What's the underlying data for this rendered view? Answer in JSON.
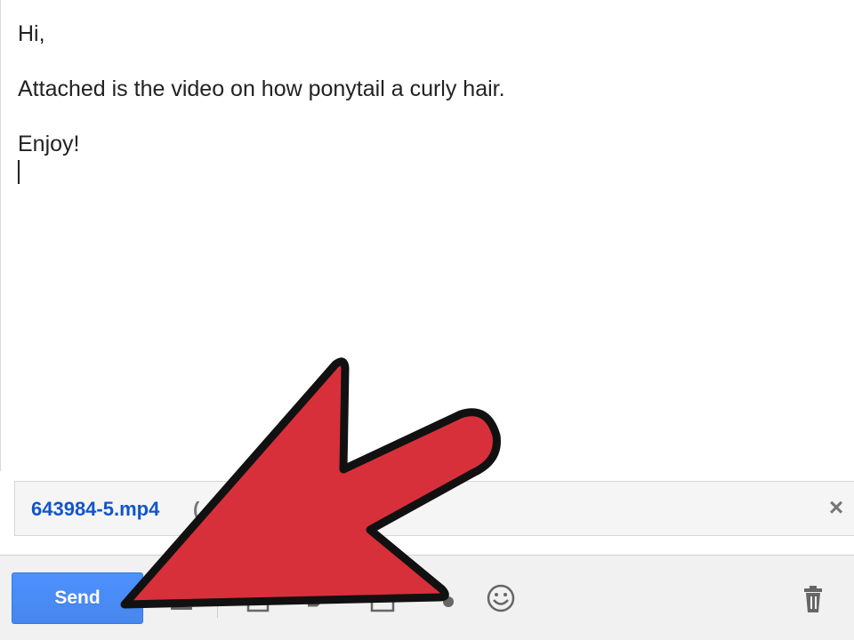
{
  "message": {
    "greeting": "Hi,",
    "body": "Attached is the video on how ponytail a curly hair.",
    "signoff": "Enjoy!"
  },
  "attachment": {
    "filename": "643984-5.mp4",
    "size_prefix": "(",
    "remove_icon": "close-icon"
  },
  "toolbar": {
    "send_label": "Send",
    "icons": [
      "formatting-icon",
      "attach-icon",
      "drive-icon",
      "photo-icon",
      "link-icon",
      "emoji-icon",
      "trash-icon"
    ]
  },
  "colors": {
    "send_button": "#4d90fe",
    "link_blue": "#1155cc",
    "arrow_red": "#d8303b"
  }
}
